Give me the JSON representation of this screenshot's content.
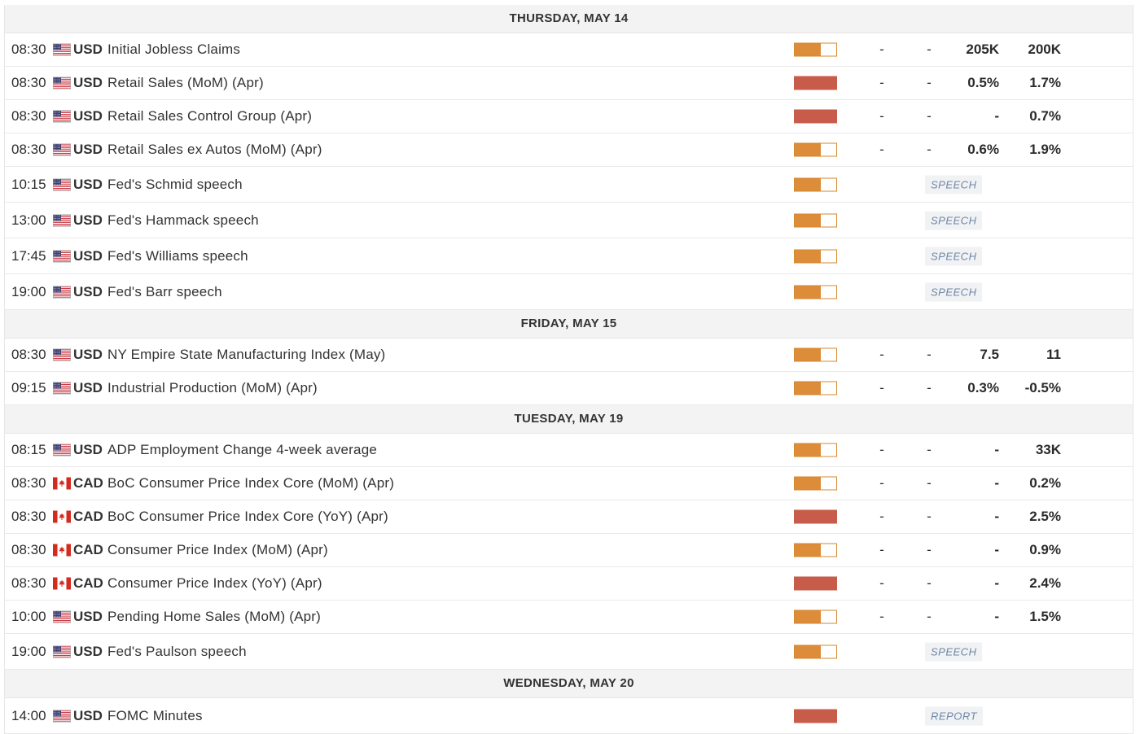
{
  "colors": {
    "medium": "#dd8c3a",
    "high": "#c85c4a",
    "header_bg": "#f3f3f4",
    "tag_text": "#6f87a8"
  },
  "days": [
    {
      "title": "THURSDAY, MAY 14",
      "events": [
        {
          "time": "08:30",
          "currency": "USD",
          "flag": "us-flag-icon",
          "name": "Initial Jobless Claims",
          "volatility": "medium",
          "actual": "-",
          "deviation": "-",
          "consensus": "205K",
          "previous": "200K"
        },
        {
          "time": "08:30",
          "currency": "USD",
          "flag": "us-flag-icon",
          "name": "Retail Sales (MoM) (Apr)",
          "volatility": "high",
          "actual": "-",
          "deviation": "-",
          "consensus": "0.5%",
          "previous": "1.7%"
        },
        {
          "time": "08:30",
          "currency": "USD",
          "flag": "us-flag-icon",
          "name": "Retail Sales Control Group (Apr)",
          "volatility": "high",
          "actual": "-",
          "deviation": "-",
          "consensus": "-",
          "previous": "0.7%"
        },
        {
          "time": "08:30",
          "currency": "USD",
          "flag": "us-flag-icon",
          "name": "Retail Sales ex Autos (MoM) (Apr)",
          "volatility": "medium",
          "actual": "-",
          "deviation": "-",
          "consensus": "0.6%",
          "previous": "1.9%"
        },
        {
          "time": "10:15",
          "currency": "USD",
          "flag": "us-flag-icon",
          "name": "Fed's Schmid speech",
          "volatility": "medium",
          "tag": "SPEECH"
        },
        {
          "time": "13:00",
          "currency": "USD",
          "flag": "us-flag-icon",
          "name": "Fed's Hammack speech",
          "volatility": "medium",
          "tag": "SPEECH"
        },
        {
          "time": "17:45",
          "currency": "USD",
          "flag": "us-flag-icon",
          "name": "Fed's Williams speech",
          "volatility": "medium",
          "tag": "SPEECH"
        },
        {
          "time": "19:00",
          "currency": "USD",
          "flag": "us-flag-icon",
          "name": "Fed's Barr speech",
          "volatility": "medium",
          "tag": "SPEECH"
        }
      ]
    },
    {
      "title": "FRIDAY, MAY 15",
      "events": [
        {
          "time": "08:30",
          "currency": "USD",
          "flag": "us-flag-icon",
          "name": "NY Empire State Manufacturing Index (May)",
          "volatility": "medium",
          "actual": "-",
          "deviation": "-",
          "consensus": "7.5",
          "previous": "11"
        },
        {
          "time": "09:15",
          "currency": "USD",
          "flag": "us-flag-icon",
          "name": "Industrial Production (MoM) (Apr)",
          "volatility": "medium",
          "actual": "-",
          "deviation": "-",
          "consensus": "0.3%",
          "previous": "-0.5%"
        }
      ]
    },
    {
      "title": "TUESDAY, MAY 19",
      "events": [
        {
          "time": "08:15",
          "currency": "USD",
          "flag": "us-flag-icon",
          "name": "ADP Employment Change 4-week average",
          "volatility": "medium",
          "actual": "-",
          "deviation": "-",
          "consensus": "-",
          "previous": "33K"
        },
        {
          "time": "08:30",
          "currency": "CAD",
          "flag": "ca-flag-icon",
          "name": "BoC Consumer Price Index Core (MoM) (Apr)",
          "volatility": "medium",
          "actual": "-",
          "deviation": "-",
          "consensus": "-",
          "previous": "0.2%"
        },
        {
          "time": "08:30",
          "currency": "CAD",
          "flag": "ca-flag-icon",
          "name": "BoC Consumer Price Index Core (YoY) (Apr)",
          "volatility": "high",
          "actual": "-",
          "deviation": "-",
          "consensus": "-",
          "previous": "2.5%"
        },
        {
          "time": "08:30",
          "currency": "CAD",
          "flag": "ca-flag-icon",
          "name": "Consumer Price Index (MoM) (Apr)",
          "volatility": "medium",
          "actual": "-",
          "deviation": "-",
          "consensus": "-",
          "previous": "0.9%"
        },
        {
          "time": "08:30",
          "currency": "CAD",
          "flag": "ca-flag-icon",
          "name": "Consumer Price Index (YoY) (Apr)",
          "volatility": "high",
          "actual": "-",
          "deviation": "-",
          "consensus": "-",
          "previous": "2.4%"
        },
        {
          "time": "10:00",
          "currency": "USD",
          "flag": "us-flag-icon",
          "name": "Pending Home Sales (MoM) (Apr)",
          "volatility": "medium",
          "actual": "-",
          "deviation": "-",
          "consensus": "-",
          "previous": "1.5%"
        },
        {
          "time": "19:00",
          "currency": "USD",
          "flag": "us-flag-icon",
          "name": "Fed's Paulson speech",
          "volatility": "medium",
          "tag": "SPEECH"
        }
      ]
    },
    {
      "title": "WEDNESDAY, MAY 20",
      "events": [
        {
          "time": "14:00",
          "currency": "USD",
          "flag": "us-flag-icon",
          "name": "FOMC Minutes",
          "volatility": "high",
          "tag": "REPORT"
        }
      ]
    }
  ]
}
